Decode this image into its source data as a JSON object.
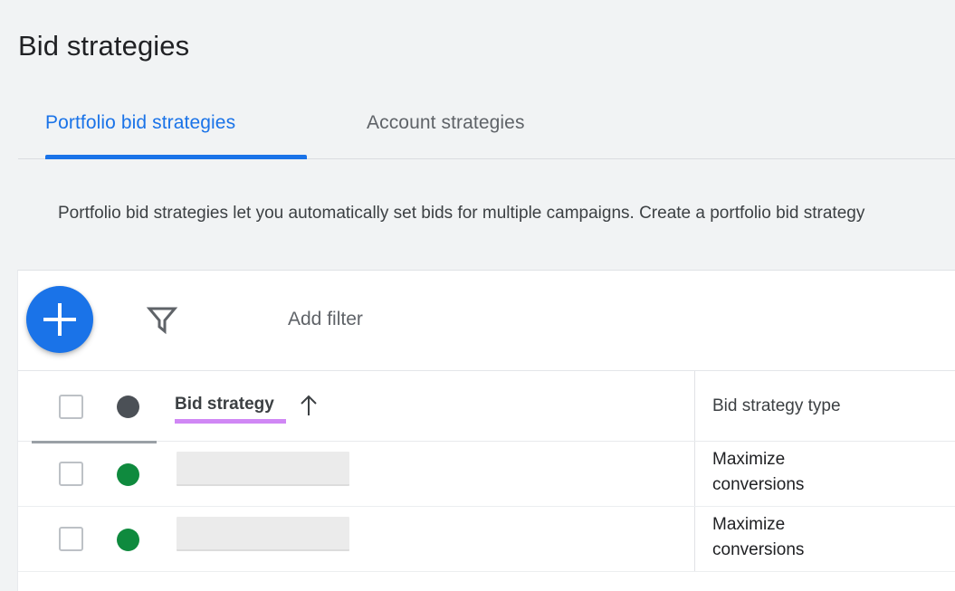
{
  "page": {
    "title": "Bid strategies",
    "background_color": "#f1f3f4"
  },
  "tabs": {
    "active_index": 0,
    "items": [
      {
        "label": "Portfolio bid strategies",
        "active": true
      },
      {
        "label": "Account strategies",
        "active": false
      }
    ],
    "accent_color": "#1a73e8"
  },
  "description": {
    "text": "Portfolio bid strategies let you automatically set bids for multiple campaigns. Create a portfolio bid strategy"
  },
  "toolbar": {
    "create_button": {
      "icon": "plus-icon",
      "label": "",
      "color": "#1a73e8"
    },
    "filter": {
      "icon": "funnel-icon",
      "label": "Add filter"
    }
  },
  "table": {
    "header": {
      "select_all_checkbox": {
        "checked": false
      },
      "status_dot": {
        "color": "#4b5056"
      },
      "columns": [
        {
          "label": "Bid strategy",
          "sorted": true,
          "sort_direction": "ascending",
          "sort_icon": "arrow-up-icon",
          "highlight_color": "#d087f5"
        },
        {
          "label": "Bid strategy type",
          "sorted": false
        }
      ]
    },
    "rows": [
      {
        "checkbox": {
          "checked": false
        },
        "status_dot": {
          "color": "#0f8a3e",
          "state": "enabled"
        },
        "bid_strategy": "",
        "bid_strategy_redacted": true,
        "bid_strategy_type": "Maximize conversions"
      },
      {
        "checkbox": {
          "checked": false
        },
        "status_dot": {
          "color": "#0f8a3e",
          "state": "enabled"
        },
        "bid_strategy": "",
        "bid_strategy_redacted": true,
        "bid_strategy_type": "Maximize conversions"
      }
    ]
  }
}
